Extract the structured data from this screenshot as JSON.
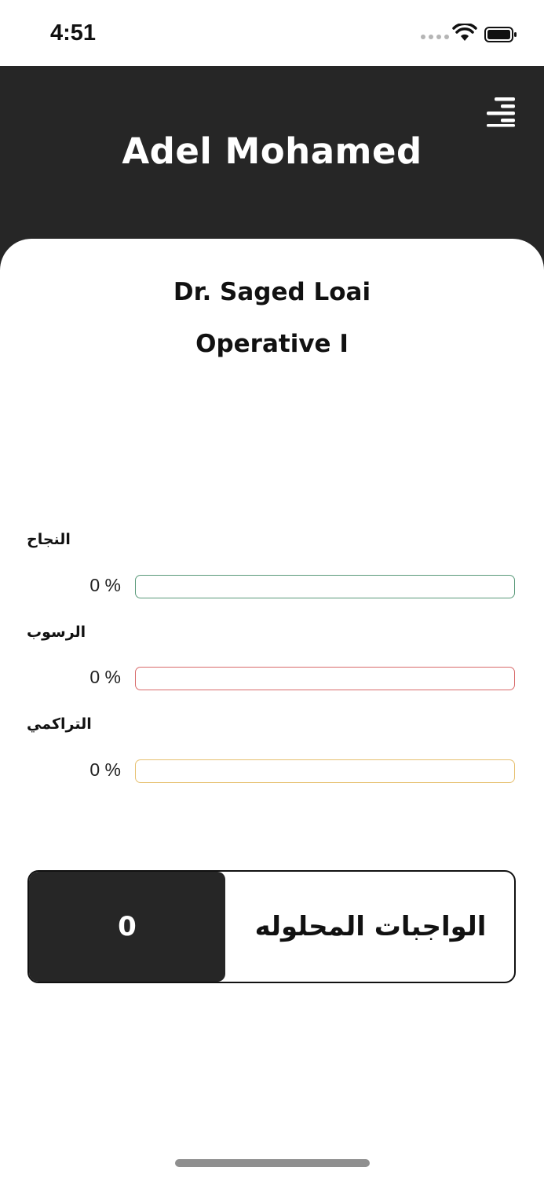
{
  "status_bar": {
    "time": "4:51",
    "icons": [
      "signal-icon",
      "wifi-icon",
      "battery-icon"
    ]
  },
  "header": {
    "user_name": "Adel Mohamed",
    "menu_icon": "menu-icon",
    "background": "#262626"
  },
  "course": {
    "doctor": "Dr. Saged Loai",
    "name": "Operative I"
  },
  "stats": [
    {
      "label": "النجاح",
      "value_text": "0 %",
      "value": 0,
      "color": "#5a9a7a"
    },
    {
      "label": "الرسوب",
      "value_text": "0 %",
      "value": 0,
      "color": "#d86a6a"
    },
    {
      "label": "التراكمي",
      "value_text": "0 %",
      "value": 0,
      "color": "#e6c070"
    }
  ],
  "solved": {
    "label": "الواجبات المحلوله",
    "count": "0"
  }
}
